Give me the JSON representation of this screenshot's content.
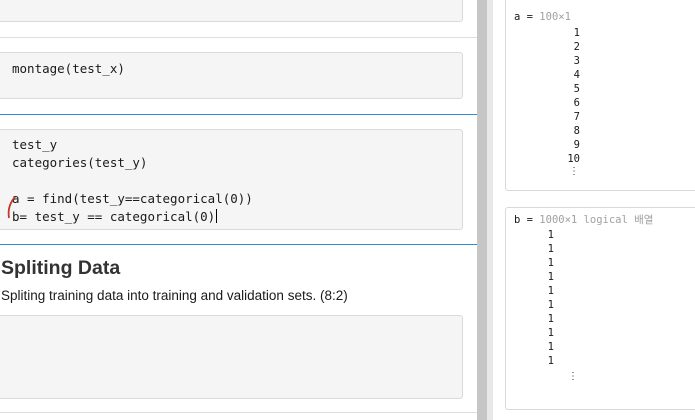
{
  "editor": {
    "cell1": {
      "lines": [
        "montage(test_x)"
      ]
    },
    "cell2": {
      "lines": [
        "test_y",
        "categories(test_y)",
        "",
        "a = find(test_y==categorical(0))",
        "b= test_y == categorical(0)"
      ]
    },
    "section": {
      "title": "Spliting Data",
      "text": "Spliting training data into training and validation sets. (8:2)"
    }
  },
  "output": {
    "var_a": {
      "name": "a",
      "eq": " = ",
      "dims": "100×1",
      "values": [
        "1",
        "2",
        "3",
        "4",
        "5",
        "6",
        "7",
        "8",
        "9",
        "10"
      ],
      "more": "⋮"
    },
    "var_b": {
      "name": "b",
      "eq": " = ",
      "dims": "1000×1 logical 배열",
      "values": [
        "1",
        "1",
        "1",
        "1",
        "1",
        "1",
        "1",
        "1",
        "1",
        "1"
      ],
      "more": "⋮"
    }
  },
  "colors": {
    "active_cell_line": "#2e8cd1",
    "run_marker": "#c0392b",
    "cell_bg": "#f5f5f5"
  }
}
